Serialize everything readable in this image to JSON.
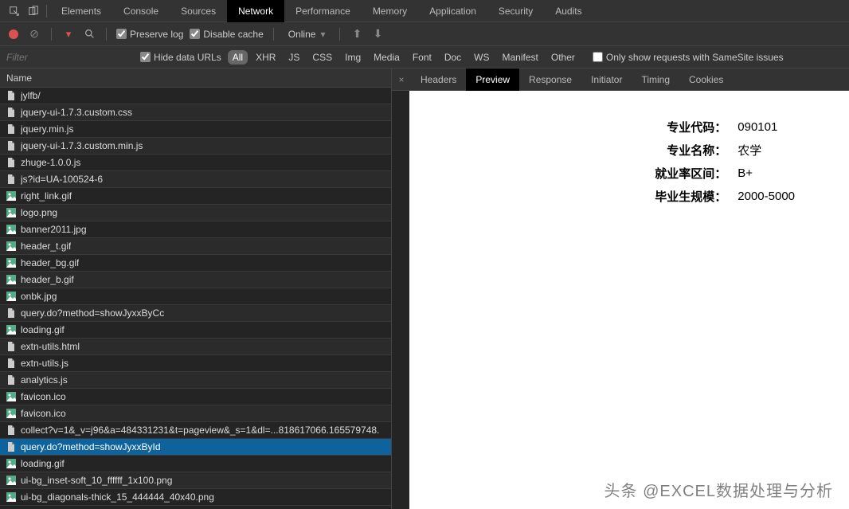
{
  "top_tabs": {
    "items": [
      "Elements",
      "Console",
      "Sources",
      "Network",
      "Performance",
      "Memory",
      "Application",
      "Security",
      "Audits"
    ],
    "active": "Network"
  },
  "toolbar": {
    "preserve_log_label": "Preserve log",
    "preserve_log_checked": true,
    "disable_cache_label": "Disable cache",
    "disable_cache_checked": true,
    "throttle": "Online"
  },
  "filter": {
    "placeholder": "Filter",
    "hide_data_urls_label": "Hide data URLs",
    "hide_data_urls_checked": true,
    "types": [
      "All",
      "XHR",
      "JS",
      "CSS",
      "Img",
      "Media",
      "Font",
      "Doc",
      "WS",
      "Manifest",
      "Other"
    ],
    "active_type": "All",
    "samesite_label": "Only show requests with SameSite issues",
    "samesite_checked": false
  },
  "list": {
    "header": "Name",
    "rows": [
      {
        "name": "jylfb/",
        "icon": "doc"
      },
      {
        "name": "jquery-ui-1.7.3.custom.css",
        "icon": "doc"
      },
      {
        "name": "jquery.min.js",
        "icon": "doc"
      },
      {
        "name": "jquery-ui-1.7.3.custom.min.js",
        "icon": "doc"
      },
      {
        "name": "zhuge-1.0.0.js",
        "icon": "doc"
      },
      {
        "name": "js?id=UA-100524-6",
        "icon": "doc"
      },
      {
        "name": "right_link.gif",
        "icon": "img"
      },
      {
        "name": "logo.png",
        "icon": "img"
      },
      {
        "name": "banner2011.jpg",
        "icon": "img"
      },
      {
        "name": "header_t.gif",
        "icon": "img"
      },
      {
        "name": "header_bg.gif",
        "icon": "img"
      },
      {
        "name": "header_b.gif",
        "icon": "img"
      },
      {
        "name": "onbk.jpg",
        "icon": "img"
      },
      {
        "name": "query.do?method=showJyxxByCc",
        "icon": "doc"
      },
      {
        "name": "loading.gif",
        "icon": "img"
      },
      {
        "name": "extn-utils.html",
        "icon": "doc"
      },
      {
        "name": "extn-utils.js",
        "icon": "doc"
      },
      {
        "name": "analytics.js",
        "icon": "doc"
      },
      {
        "name": "favicon.ico",
        "icon": "img"
      },
      {
        "name": "favicon.ico",
        "icon": "img"
      },
      {
        "name": "collect?v=1&_v=j96&a=484331231&t=pageview&_s=1&dl=...818617066.165579748.",
        "icon": "doc"
      },
      {
        "name": "query.do?method=showJyxxById",
        "icon": "doc",
        "selected": true
      },
      {
        "name": "loading.gif",
        "icon": "img"
      },
      {
        "name": "ui-bg_inset-soft_10_ffffff_1x100.png",
        "icon": "img"
      },
      {
        "name": "ui-bg_diagonals-thick_15_444444_40x40.png",
        "icon": "img"
      }
    ]
  },
  "detail_tabs": {
    "items": [
      "Headers",
      "Preview",
      "Response",
      "Initiator",
      "Timing",
      "Cookies"
    ],
    "active": "Preview"
  },
  "preview": {
    "rows": [
      {
        "k": "专业代码：",
        "v": "090101"
      },
      {
        "k": "专业名称：",
        "v": "农学"
      },
      {
        "k": "就业率区间：",
        "v": "B+"
      },
      {
        "k": "毕业生规模：",
        "v": "2000-5000"
      }
    ]
  },
  "watermark": "头条 @EXCEL数据处理与分析"
}
